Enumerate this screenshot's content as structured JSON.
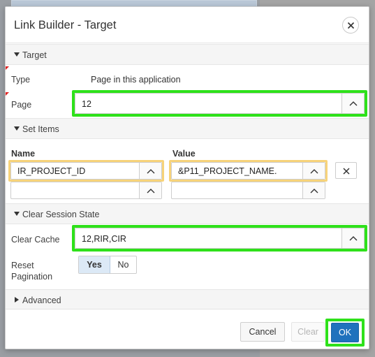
{
  "dialog": {
    "title": "Link Builder - Target",
    "close_icon": "close-icon"
  },
  "target_section": {
    "label": "Target",
    "type_label": "Type",
    "type_value": "Page in this application",
    "page_label": "Page",
    "page_value": "12"
  },
  "set_items_section": {
    "label": "Set Items",
    "name_header": "Name",
    "value_header": "Value",
    "rows": [
      {
        "name": "IR_PROJECT_ID",
        "value": "&P11_PROJECT_NAME."
      },
      {
        "name": "",
        "value": ""
      }
    ]
  },
  "clear_session_section": {
    "label": "Clear Session State",
    "clear_cache_label": "Clear Cache",
    "clear_cache_value": "12,RIR,CIR",
    "reset_pagination_label_1": "Reset",
    "reset_pagination_label_2": "Pagination",
    "yes_label": "Yes",
    "no_label": "No",
    "selected": "Yes"
  },
  "advanced_section": {
    "label": "Advanced"
  },
  "footer": {
    "cancel_label": "Cancel",
    "clear_label": "Clear",
    "ok_label": "OK"
  },
  "colors": {
    "highlight_green": "#2ee11a",
    "highlight_yellow": "#f7d37a",
    "primary_button": "#1f72bd",
    "toggle_selected": "#dce9f6"
  }
}
